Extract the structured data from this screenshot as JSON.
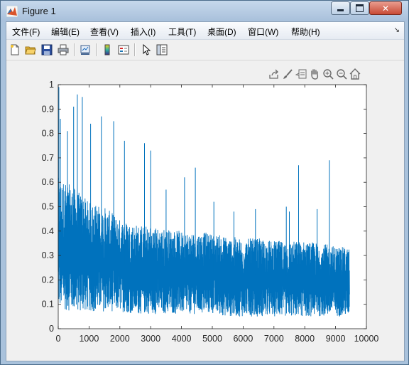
{
  "window": {
    "title": "Figure 1"
  },
  "menu": {
    "items": [
      {
        "label": "文件(F)"
      },
      {
        "label": "编辑(E)"
      },
      {
        "label": "查看(V)"
      },
      {
        "label": "插入(I)"
      },
      {
        "label": "工具(T)"
      },
      {
        "label": "桌面(D)"
      },
      {
        "label": "窗口(W)"
      },
      {
        "label": "帮助(H)"
      }
    ]
  },
  "toolbar": {
    "buttons": [
      "new-figure-icon",
      "open-file-icon",
      "save-icon",
      "print-icon",
      "link-plot-icon",
      "colorbar-icon",
      "legend-icon",
      "pointer-icon",
      "property-inspector-icon"
    ]
  },
  "axes_toolbar": {
    "buttons": [
      "export-icon",
      "brush-icon",
      "data-tips-icon",
      "pan-icon",
      "zoom-in-icon",
      "zoom-out-icon",
      "home-icon"
    ]
  },
  "colors": {
    "line": "#0072bd",
    "axes_bg": "#ffffff",
    "figure_bg": "#f0f0f0"
  },
  "chart_data": {
    "type": "line",
    "title": "",
    "xlabel": "",
    "ylabel": "",
    "xlim": [
      0,
      10000
    ],
    "ylim": [
      0,
      1
    ],
    "xticks": [
      0,
      1000,
      2000,
      3000,
      4000,
      5000,
      6000,
      7000,
      8000,
      9000,
      10000
    ],
    "yticks": [
      0,
      0.1,
      0.2,
      0.3,
      0.4,
      0.5,
      0.6,
      0.7,
      0.8,
      0.9,
      1
    ],
    "grid": false,
    "n_points": 9450,
    "series": [
      {
        "color": "#0072bd",
        "x": [
          0,
          500,
          1000,
          1500,
          2000,
          2500,
          3000,
          3500,
          4000,
          4500,
          5000,
          5500,
          6000,
          6500,
          7000,
          7500,
          8000,
          8500,
          9000,
          9450
        ],
        "upper": [
          0.62,
          0.58,
          0.52,
          0.5,
          0.45,
          0.43,
          0.42,
          0.41,
          0.4,
          0.4,
          0.39,
          0.38,
          0.37,
          0.37,
          0.36,
          0.36,
          0.36,
          0.35,
          0.34,
          0.33
        ],
        "lower": [
          0.08,
          0.07,
          0.07,
          0.07,
          0.07,
          0.06,
          0.06,
          0.06,
          0.06,
          0.06,
          0.06,
          0.05,
          0.05,
          0.05,
          0.05,
          0.05,
          0.05,
          0.05,
          0.05,
          0.05
        ],
        "spikes": [
          {
            "x": 20,
            "y": 0.99
          },
          {
            "x": 70,
            "y": 0.86
          },
          {
            "x": 300,
            "y": 0.81
          },
          {
            "x": 500,
            "y": 0.91
          },
          {
            "x": 620,
            "y": 0.96
          },
          {
            "x": 780,
            "y": 0.95
          },
          {
            "x": 1050,
            "y": 0.84
          },
          {
            "x": 1400,
            "y": 0.87
          },
          {
            "x": 1800,
            "y": 0.85
          },
          {
            "x": 2150,
            "y": 0.77
          },
          {
            "x": 2800,
            "y": 0.76
          },
          {
            "x": 3000,
            "y": 0.73
          },
          {
            "x": 3500,
            "y": 0.57
          },
          {
            "x": 4100,
            "y": 0.62
          },
          {
            "x": 4450,
            "y": 0.66
          },
          {
            "x": 5050,
            "y": 0.52
          },
          {
            "x": 5700,
            "y": 0.48
          },
          {
            "x": 6400,
            "y": 0.49
          },
          {
            "x": 7400,
            "y": 0.5
          },
          {
            "x": 7500,
            "y": 0.48
          },
          {
            "x": 7800,
            "y": 0.67
          },
          {
            "x": 8400,
            "y": 0.49
          },
          {
            "x": 8800,
            "y": 0.69
          },
          {
            "x": 9200,
            "y": 0.32
          }
        ]
      }
    ]
  }
}
